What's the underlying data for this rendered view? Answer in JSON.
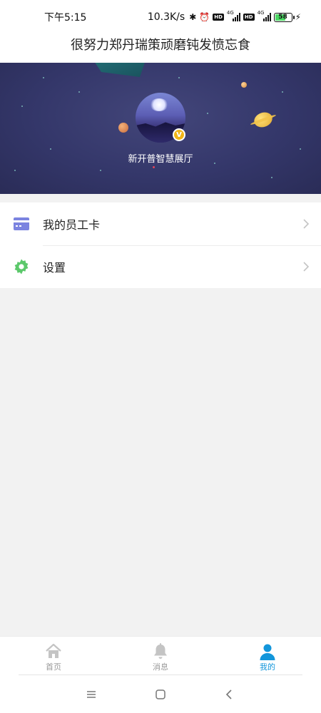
{
  "status_bar": {
    "time": "下午5:15",
    "speed": "10.3K/s",
    "battery": "58",
    "network_1": "4G",
    "network_2": "4G",
    "hd_label": "HD"
  },
  "header": {
    "title": "很努力郑丹瑞策顽磨钝发愤忘食"
  },
  "profile": {
    "name": "新开普智慧展厅",
    "badge": "V"
  },
  "menu": {
    "items": [
      {
        "label": "我的员工卡",
        "icon": "id-card-icon",
        "icon_color": "#7b83e0"
      },
      {
        "label": "设置",
        "icon": "gear-icon",
        "icon_color": "#5cc86b"
      }
    ]
  },
  "bottom_nav": {
    "items": [
      {
        "label": "首页",
        "icon": "home-icon",
        "active": false
      },
      {
        "label": "消息",
        "icon": "bell-icon",
        "active": false
      },
      {
        "label": "我的",
        "icon": "user-icon",
        "active": true
      }
    ],
    "active_color": "#1296db",
    "inactive_color": "#999999"
  },
  "system_nav": {
    "icons": [
      "menu-icon",
      "home-square-icon",
      "back-icon"
    ]
  }
}
